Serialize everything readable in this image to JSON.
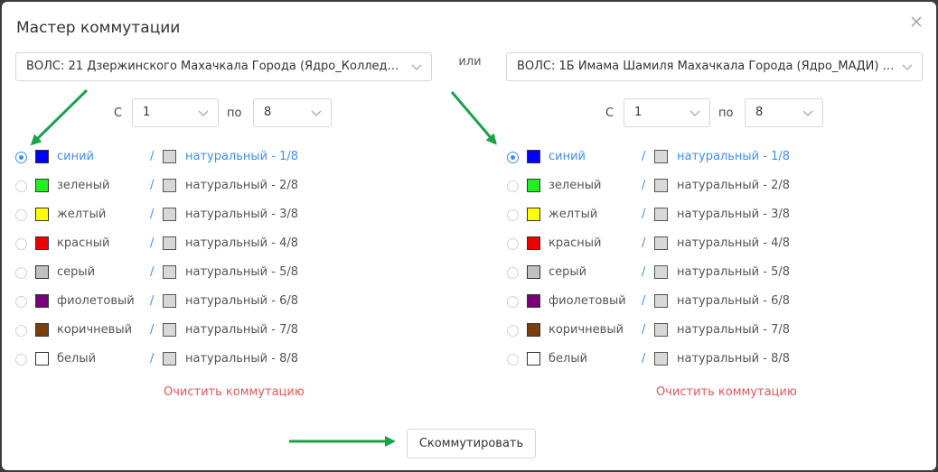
{
  "dialog": {
    "title": "Мастер коммутации",
    "or_label": "или",
    "submit_label": "Скоммутировать"
  },
  "left": {
    "cable": "ВОЛС: 21 Дзержинского Махачкала Города (Ядро_Колледж ...",
    "from_label": "С",
    "from_value": "1",
    "to_label": "по",
    "to_value": "8",
    "clear_label": "Очистить коммутацию",
    "selected_index": 0,
    "fibers": [
      {
        "color_name": "синий",
        "color": "#0000ff",
        "fiber": "натуральный - 1/8"
      },
      {
        "color_name": "зеленый",
        "color": "#22ee22",
        "fiber": "натуральный - 2/8"
      },
      {
        "color_name": "желтый",
        "color": "#ffff00",
        "fiber": "натуральный - 3/8"
      },
      {
        "color_name": "красный",
        "color": "#ee0000",
        "fiber": "натуральный - 4/8"
      },
      {
        "color_name": "серый",
        "color": "#c0c0c0",
        "fiber": "натуральный - 5/8"
      },
      {
        "color_name": "фиолетовый",
        "color": "#7a007a",
        "fiber": "натуральный - 6/8"
      },
      {
        "color_name": "коричневый",
        "color": "#7a3f0a",
        "fiber": "натуральный - 7/8"
      },
      {
        "color_name": "белый",
        "color": "#ffffff",
        "fiber": "натуральный - 8/8"
      }
    ]
  },
  "right": {
    "cable": "ВОЛС: 1Б Имама Шамиля Махачкала Города (Ядро_МАДИ) #...",
    "from_label": "С",
    "from_value": "1",
    "to_label": "по",
    "to_value": "8",
    "clear_label": "Очистить коммутацию",
    "selected_index": 0,
    "fibers": [
      {
        "color_name": "синий",
        "color": "#0000ff",
        "fiber": "натуральный - 1/8"
      },
      {
        "color_name": "зеленый",
        "color": "#22ee22",
        "fiber": "натуральный - 2/8"
      },
      {
        "color_name": "желтый",
        "color": "#ffff00",
        "fiber": "натуральный - 3/8"
      },
      {
        "color_name": "красный",
        "color": "#ee0000",
        "fiber": "натуральный - 4/8"
      },
      {
        "color_name": "серый",
        "color": "#c0c0c0",
        "fiber": "натуральный - 5/8"
      },
      {
        "color_name": "фиолетовый",
        "color": "#7a007a",
        "fiber": "натуральный - 6/8"
      },
      {
        "color_name": "коричневый",
        "color": "#7a3f0a",
        "fiber": "натуральный - 7/8"
      },
      {
        "color_name": "белый",
        "color": "#ffffff",
        "fiber": "натуральный - 8/8"
      }
    ]
  },
  "colors": {
    "accent": "#3d8ef0",
    "danger": "#e05757",
    "annotation_arrow": "#1aa24a",
    "fiber_natural": "#d8d8d8"
  },
  "icons": {
    "close": "close-icon",
    "dropdown": "chevron-down-icon",
    "annotation": "green-arrow-annotation"
  }
}
